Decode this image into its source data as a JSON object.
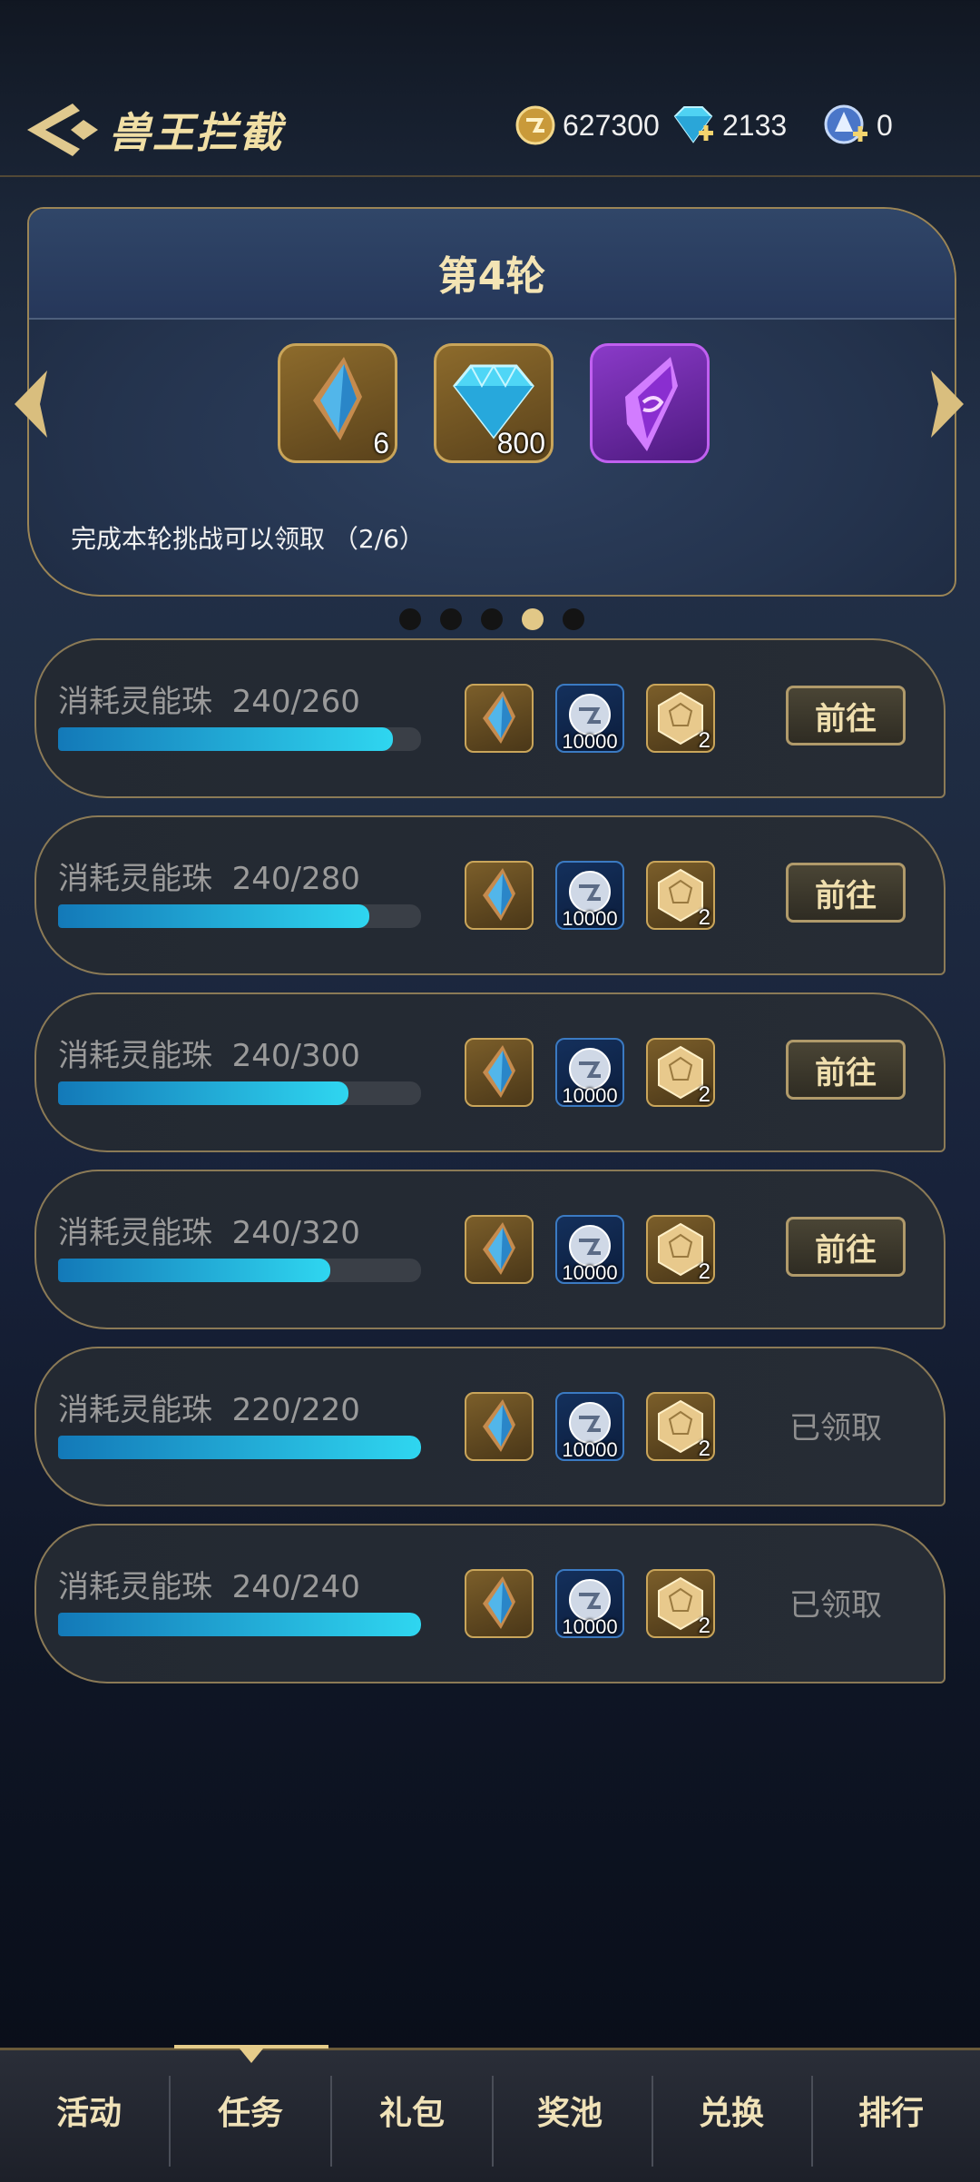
{
  "header": {
    "title": "兽王拦截",
    "currencies": [
      {
        "icon": "gold-coin-icon",
        "value": "627300"
      },
      {
        "icon": "diamond-icon",
        "value": "2133"
      },
      {
        "icon": "blue-token-icon",
        "value": "0"
      }
    ]
  },
  "round": {
    "title": "第4轮",
    "description": "完成本轮挑战可以领取 （2/6）",
    "prizes": [
      {
        "icon": "blue-crystal-icon",
        "count": "6"
      },
      {
        "icon": "diamond-icon",
        "count": "800"
      },
      {
        "icon": "purple-gem-icon",
        "count": ""
      }
    ],
    "pager": {
      "pages": 5,
      "active": 4
    }
  },
  "tasks": [
    {
      "label": "消耗灵能珠",
      "progress": "240/260",
      "fraction": 0.923,
      "coin_count": "10000",
      "dice_count": "2",
      "action": "前往",
      "claimed": false
    },
    {
      "label": "消耗灵能珠",
      "progress": "240/280",
      "fraction": 0.857,
      "coin_count": "10000",
      "dice_count": "2",
      "action": "前往",
      "claimed": false
    },
    {
      "label": "消耗灵能珠",
      "progress": "240/300",
      "fraction": 0.8,
      "coin_count": "10000",
      "dice_count": "2",
      "action": "前往",
      "claimed": false
    },
    {
      "label": "消耗灵能珠",
      "progress": "240/320",
      "fraction": 0.75,
      "coin_count": "10000",
      "dice_count": "2",
      "action": "前往",
      "claimed": false
    },
    {
      "label": "消耗灵能珠",
      "progress": "220/220",
      "fraction": 1.0,
      "coin_count": "10000",
      "dice_count": "2",
      "action": "已领取",
      "claimed": true
    },
    {
      "label": "消耗灵能珠",
      "progress": "240/240",
      "fraction": 1.0,
      "coin_count": "10000",
      "dice_count": "2",
      "action": "已领取",
      "claimed": true
    }
  ],
  "nav": {
    "items": [
      "活动",
      "任务",
      "礼包",
      "奖池",
      "兑换",
      "排行"
    ],
    "active": "任务"
  }
}
